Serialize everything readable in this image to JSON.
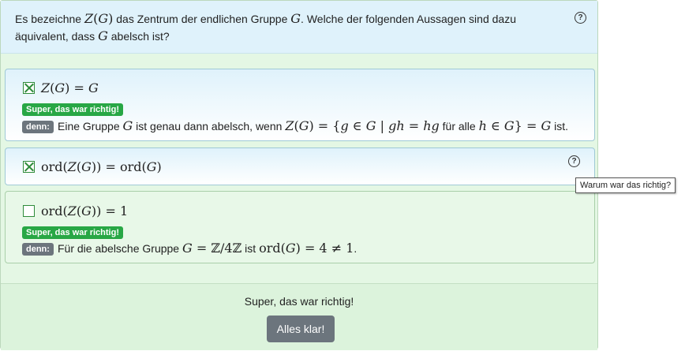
{
  "question": {
    "text_html": "Es bezeichne <span class=\"m\">Z</span><span class=\"mr\">(</span><span class=\"m\">G</span><span class=\"mr\">)</span> das Zentrum der endlichen Gruppe <span class=\"m\">G</span>. Welche der folgenden Aussagen sind dazu äquivalent, dass <span class=\"m\">G</span> abelsch ist?",
    "help_icon": "question-circle-icon"
  },
  "answers": [
    {
      "label_html": "<span class=\"m\">Z</span><span class=\"mr\">(</span><span class=\"m\">G</span><span class=\"mr\">) = </span><span class=\"m\">G</span>",
      "checked": true,
      "badge": "Super, das war richtig!",
      "reason_prefix": "denn:",
      "reason_html": "Eine Gruppe <span class=\"m\">G</span> ist genau dann abelsch, wenn <span class=\"m\">Z</span><span class=\"mr\">(</span><span class=\"m\">G</span><span class=\"mr\">) = {</span><span class=\"m\">g</span><span class=\"mr\"> ∈ </span><span class=\"m\">G</span><span class=\"mr\"> | </span><span class=\"m\">gh</span><span class=\"mr\"> = </span><span class=\"m\">hg</span> für alle <span class=\"m\">h</span><span class=\"mr\"> ∈ </span><span class=\"m\">G</span><span class=\"mr\">} = </span><span class=\"m\">G</span> ist."
    },
    {
      "label_html": "<span class=\"mr\">ord(</span><span class=\"m\">Z</span><span class=\"mr\">(</span><span class=\"m\">G</span><span class=\"mr\">)) = ord(</span><span class=\"m\">G</span><span class=\"mr\">)</span>",
      "checked": true,
      "help_icon": "question-circle-icon"
    },
    {
      "label_html": "<span class=\"mr\">ord(</span><span class=\"m\">Z</span><span class=\"mr\">(</span><span class=\"m\">G</span><span class=\"mr\">)) = 1</span>",
      "checked": false,
      "badge": "Super, das war richtig!",
      "reason_prefix": "denn:",
      "reason_html": "Für die abelsche Gruppe <span class=\"m\">G</span><span class=\"mr\"> = ℤ/4ℤ</span> ist <span class=\"mr\">ord(</span><span class=\"m\">G</span><span class=\"mr\">) = 4 ≠ 1</span>."
    }
  ],
  "tooltip": "Warum war das richtig?",
  "footer": {
    "feedback": "Super, das war richtig!",
    "button": "Alles klar!"
  },
  "colors": {
    "success": "#28a745",
    "secondary": "#6c757d",
    "question_bg": "#dff2fb",
    "footer_bg": "#dcf3dc"
  }
}
